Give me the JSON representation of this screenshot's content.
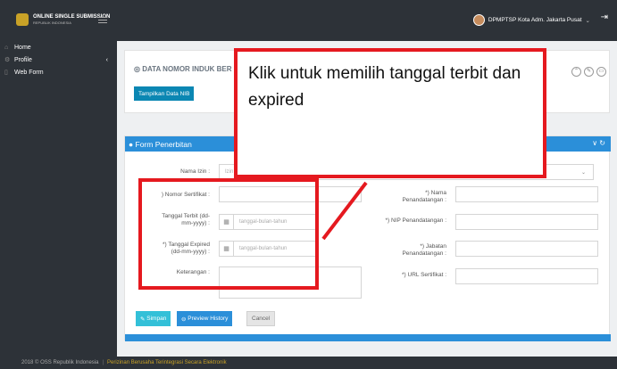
{
  "header": {
    "logo_line1": "ONLINE SINGLE SUBMISSION",
    "logo_line2": "REPUBLIK INDONESIA",
    "user_name": "DPMPTSP Kota Adm. Jakarta Pusat"
  },
  "sidebar": {
    "items": [
      {
        "label": "Home",
        "icon": "home-icon"
      },
      {
        "label": "Profile",
        "icon": "gear-icon"
      },
      {
        "label": "Web Form",
        "icon": "document-icon"
      }
    ]
  },
  "nib_card": {
    "title": "DATA NOMOR INDUK BER",
    "show_button": "Tampilkan Data NIB"
  },
  "form": {
    "header": "Form Penerbitan",
    "nama_izin_label": "Nama Izin :",
    "nama_izin_value": "Izin",
    "nomor_sertifikat_label": ") Nomor Sertifikat :",
    "tanggal_terbit_label": "Tanggal Terbit (dd-mm-yyyy) :",
    "tanggal_terbit_placeholder": "tanggal-bulan-tahun",
    "tanggal_expired_label": "*) Tanggal Expired (dd-mm-yyyy) :",
    "tanggal_expired_placeholder": "tanggal-bulan-tahun",
    "keterangan_label": "Keterangan :",
    "nama_penandatangan_label": "*) Nama Penandatangan :",
    "nip_label": "*) NIP Penandatangan :",
    "jabatan_label": "*) Jabatan Penandatangan :",
    "url_label": "*) URL Sertifikat :",
    "save_button": "Simpan",
    "preview_button": "Preview History",
    "cancel_button": "Cancel"
  },
  "footer": {
    "copyright": "2018 © OSS Republik Indonesia",
    "link": "Perizinan Berusaha Terintegrasi Secara Elektronik"
  },
  "callout": {
    "text": "Klik untuk memilih tanggal terbit dan expired"
  },
  "colors": {
    "accent": "#2b8fd9",
    "callout_border": "#e5191f",
    "topbar": "#2d3238"
  }
}
